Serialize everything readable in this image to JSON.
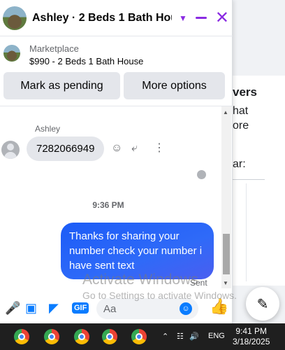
{
  "background": {
    "heading": "vers",
    "line1": "hat",
    "line2": "ore",
    "line3": "ar:"
  },
  "chat": {
    "title": "Ashley · 2 Beds 1 Bath Hou...",
    "icons": {
      "chevron": "chevron-down-icon",
      "minimize": "minimize-icon",
      "close": "close-icon"
    },
    "marketplace": {
      "label": "Marketplace",
      "listing": "$990 - 2 Beds 1 Bath House"
    },
    "actions": {
      "pending_label": "Mark as pending",
      "more_label": "More options"
    },
    "messages": [
      {
        "sender": "Ashley",
        "text": "7282066949",
        "direction": "in"
      },
      {
        "time": "9:36 PM"
      },
      {
        "text": "Thanks for sharing your number check your number i have sent text",
        "direction": "out",
        "status": "Sent"
      }
    ],
    "composer": {
      "placeholder": "Aa",
      "gif_label": "GIF"
    },
    "colors": {
      "accent": "#8a2be2",
      "messenger_blue": "#0a7cff"
    }
  },
  "watermark": {
    "line1": "Activate Windows",
    "line2": "Go to Settings to activate Windows."
  },
  "taskbar": {
    "language": "ENG",
    "time": "9:41 PM",
    "date": "3/18/2025"
  }
}
